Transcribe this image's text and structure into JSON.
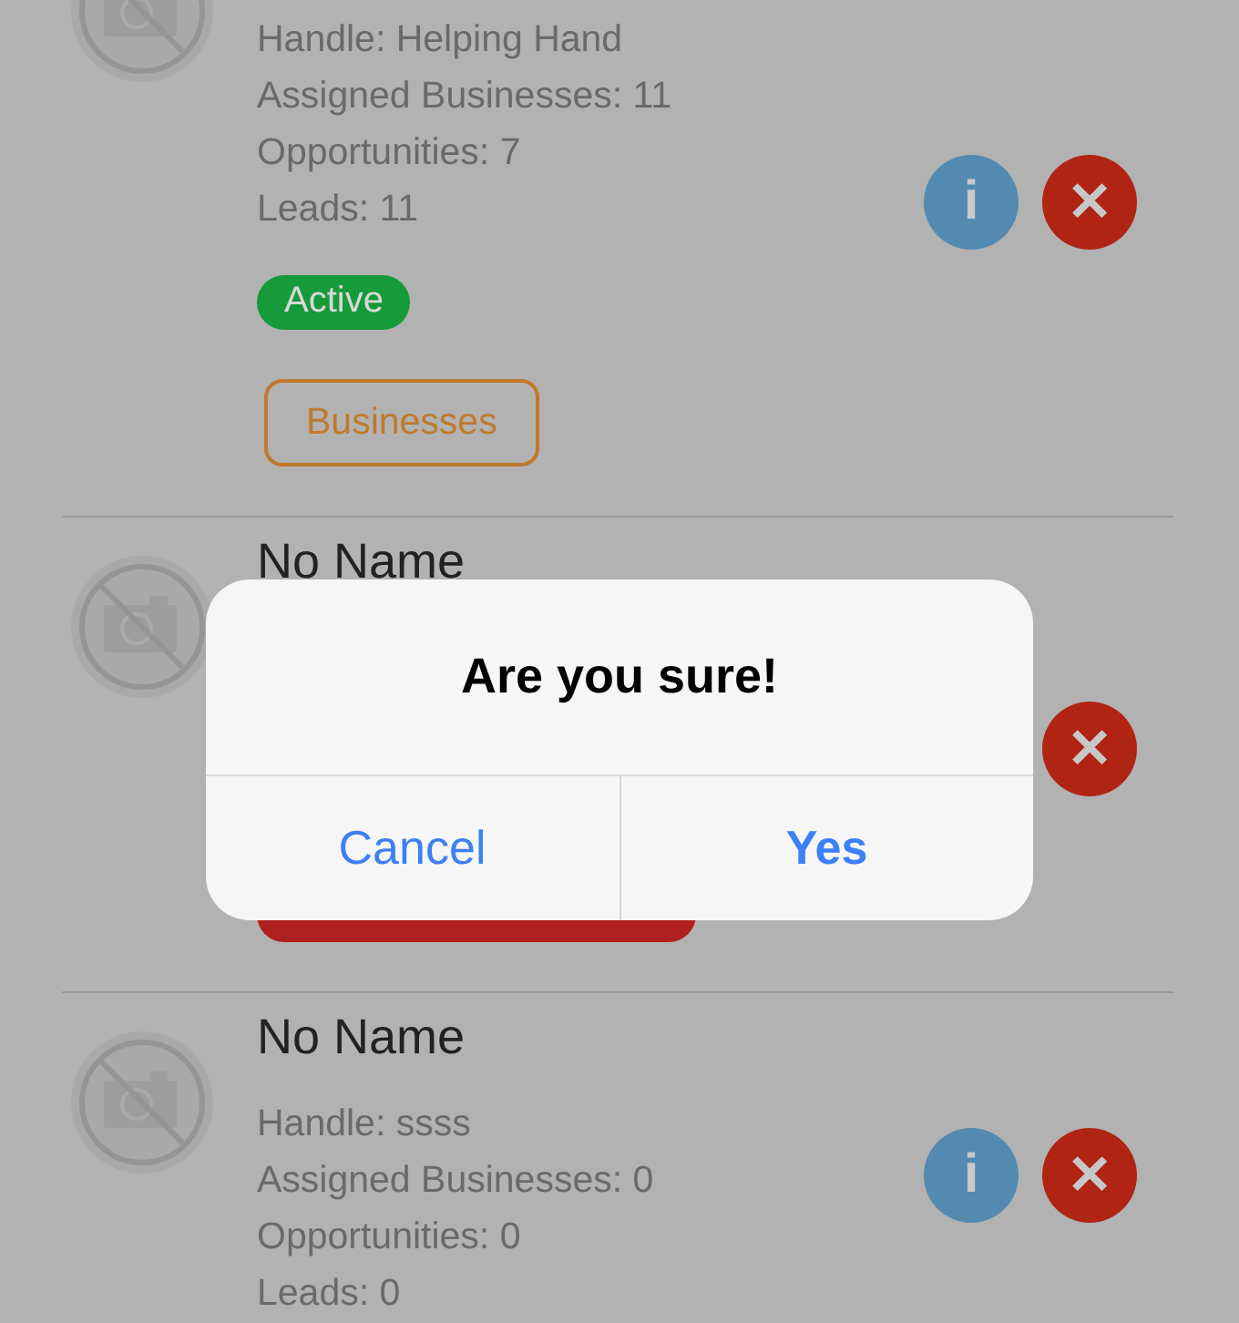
{
  "cards": [
    {
      "stats": [
        "Handle: Helping Hand",
        "Assigned Businesses: 11",
        "Opportunities: 7",
        "Leads: 11"
      ],
      "status": {
        "label": "Active",
        "color": "#179a3a"
      },
      "businesses_button": "Businesses",
      "actions": [
        {
          "kind": "info",
          "glyph": "i"
        },
        {
          "kind": "delete",
          "glyph": "✕"
        }
      ]
    },
    {
      "name": "No Name",
      "status": {
        "color": "#b02020"
      },
      "actions": [
        {
          "kind": "delete",
          "glyph": "✕"
        }
      ]
    },
    {
      "name": "No Name",
      "stats": [
        "Handle: ssss",
        "Assigned Businesses: 0",
        "Opportunities: 0",
        "Leads: 0"
      ],
      "actions": [
        {
          "kind": "info",
          "glyph": "i"
        },
        {
          "kind": "delete",
          "glyph": "✕"
        }
      ]
    }
  ],
  "dialog": {
    "title": "Are you sure!",
    "buttons": [
      {
        "label": "Cancel",
        "kind": "cancel"
      },
      {
        "label": "Yes",
        "kind": "confirm"
      }
    ]
  }
}
